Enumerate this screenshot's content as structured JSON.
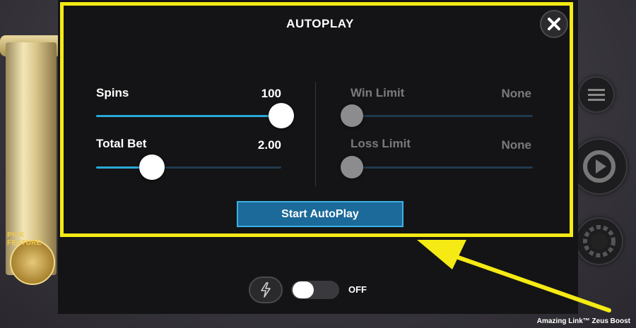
{
  "dialog": {
    "title": "AUTOPLAY",
    "close_icon": "close-icon",
    "spins": {
      "label": "Spins",
      "value": "100",
      "fraction": 1.0
    },
    "total_bet": {
      "label": "Total Bet",
      "value": "2.00",
      "fraction": 0.3
    },
    "win_limit": {
      "label": "Win Limit",
      "value": "None",
      "fraction": 0.0
    },
    "loss_limit": {
      "label": "Loss Limit",
      "value": "None",
      "fraction": 0.0
    },
    "start_button": "Start AutoPlay"
  },
  "turbo": {
    "icon": "lightning-icon",
    "toggle_label": "OFF",
    "state": "off"
  },
  "background": {
    "pick_feature_text": "PICK FEATURE",
    "game_title": "Amazing Link™ Zeus Boost"
  },
  "colors": {
    "highlight": "#f5ea14",
    "accent": "#2aa9d6",
    "button": "#1b6a9a"
  }
}
